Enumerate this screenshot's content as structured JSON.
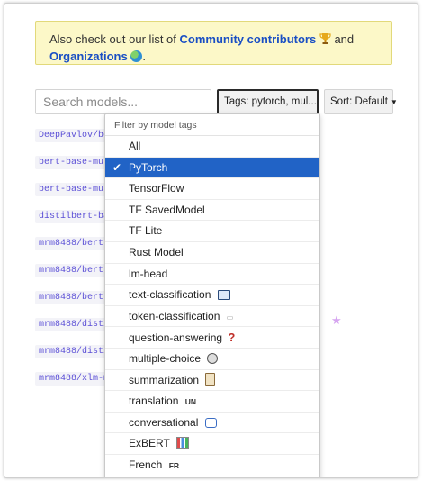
{
  "notice": {
    "prefix": "Also check out our list of",
    "community_link": "Community contributors",
    "and": "and",
    "orgs_link": "Organizations",
    "period": "."
  },
  "search": {
    "placeholder": "Search models..."
  },
  "tags_button": {
    "label": "Tags: pytorch, mul..."
  },
  "sort_button": {
    "label": "Sort: Default"
  },
  "models": [
    "DeepPavlov/ber",
    "bert-base-mult",
    "bert-base-mult",
    "distilbert-bas",
    "mrm8488/bert-m",
    "mrm8488/bert-m",
    "mrm8488/bert-m",
    "mrm8488/distil",
    "mrm8488/distil",
    "mrm8488/xlm-mu"
  ],
  "model_tail": "n",
  "dropdown": {
    "header": "Filter by model tags",
    "items": [
      {
        "label": "All",
        "icon": ""
      },
      {
        "label": "PyTorch",
        "icon": "",
        "selected": true
      },
      {
        "label": "TensorFlow",
        "icon": ""
      },
      {
        "label": "TF SavedModel",
        "icon": ""
      },
      {
        "label": "TF Lite",
        "icon": ""
      },
      {
        "label": "Rust Model",
        "icon": ""
      },
      {
        "label": "lm-head",
        "icon": ""
      },
      {
        "label": "text-classification",
        "icon": "monitor-icon"
      },
      {
        "label": "token-classification",
        "icon": "token-icon"
      },
      {
        "label": "question-answering",
        "icon": "question-icon"
      },
      {
        "label": "multiple-choice",
        "icon": "circle-icon"
      },
      {
        "label": "summarization",
        "icon": "clipboard-icon"
      },
      {
        "label": "translation",
        "icon": "un-icon",
        "icon_text": "UN"
      },
      {
        "label": "conversational",
        "icon": "speech-bubble-icon"
      },
      {
        "label": "ExBERT",
        "icon": "bar-chart-icon"
      },
      {
        "label": "French",
        "icon": "fr-flag-icon",
        "icon_text": "FR"
      }
    ]
  },
  "colors": {
    "link": "#1a4fc4",
    "selected_bg": "#2163c6",
    "model_text": "#5b4fd6",
    "notice_bg": "#fcf8c8"
  }
}
